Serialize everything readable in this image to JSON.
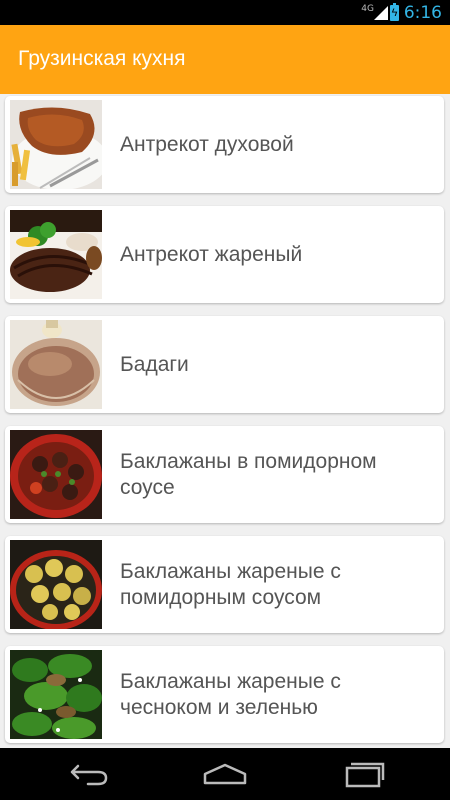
{
  "status_bar": {
    "network": "4G",
    "time": "6:16",
    "icons": [
      "signal-icon",
      "battery-charging-icon"
    ]
  },
  "app_bar": {
    "title": "Грузинская кухня"
  },
  "recipes": [
    {
      "title": "Антрекот духовой",
      "image": "baked-entrecote-photo"
    },
    {
      "title": "Антрекот жареный",
      "image": "fried-entrecote-photo"
    },
    {
      "title": "Бадаги",
      "image": "badagi-photo"
    },
    {
      "title": "Баклажаны в помидорном соусе",
      "image": "eggplant-tomato-sauce-photo"
    },
    {
      "title": "Баклажаны жареные с помидорным соусом",
      "image": "fried-eggplant-tomato-photo"
    },
    {
      "title": "Баклажаны жареные с чесноком и зеленью",
      "image": "fried-eggplant-garlic-greens-photo"
    }
  ],
  "nav_bar": {
    "icons": [
      "back-icon",
      "home-icon",
      "recent-apps-icon"
    ]
  },
  "colors": {
    "app_bar": "#ffa412",
    "accent": "#33b5e5",
    "card_text": "#555555"
  }
}
